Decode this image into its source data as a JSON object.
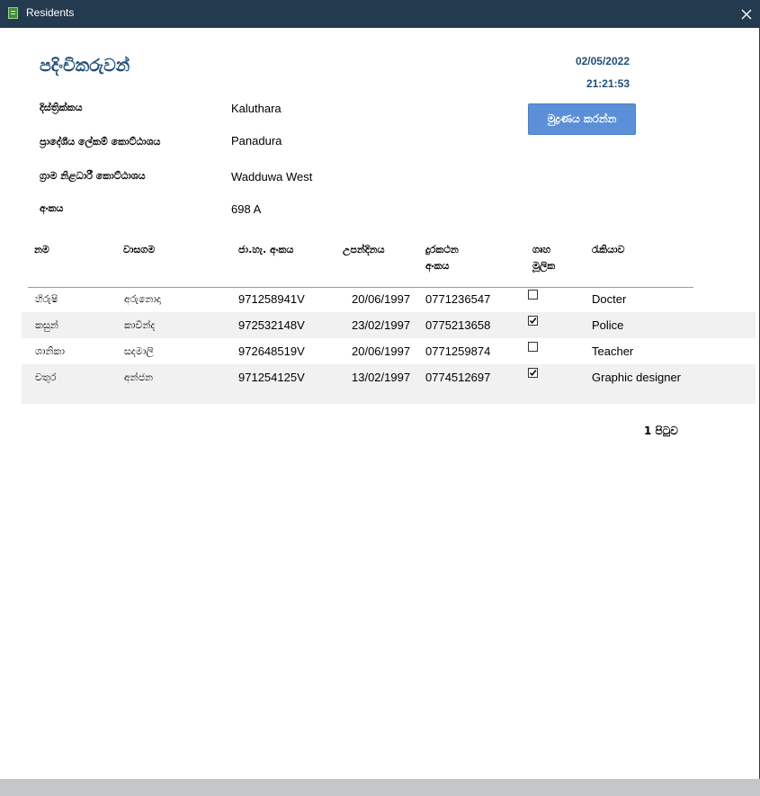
{
  "window": {
    "title": "Residents",
    "close_label": "✕"
  },
  "report": {
    "title": "පදිංචිකරුවන්",
    "date": "02/05/2022",
    "time": "21:21:53",
    "print_button": "මුද්‍රණය කරන්න"
  },
  "info": [
    {
      "label": "දිස්ත්‍රික්කය",
      "value": "Kaluthara"
    },
    {
      "label": "ප්‍රාදේශීය ලේකම් කොට්ඨාශය",
      "value": "Panadura"
    },
    {
      "label": "ග්‍රාම නිළධාරී කොට්ඨාශය",
      "value": "Wadduwa West"
    },
    {
      "label": "අංකය",
      "value": "698 A"
    }
  ],
  "table": {
    "headers": {
      "name": "නම",
      "surname": "වාසගම",
      "nic": "ජා.හැ. අංකය",
      "dob": "උපන්දිනය",
      "phone_1": "දුරකථන",
      "phone_2": "අංකය",
      "head_1": "ගෘහ",
      "head_2": "මූලික",
      "job": "රැකියාව"
    },
    "rows": [
      {
        "name": "හිරුෂි",
        "surname": "අරුනොදා",
        "nic": "971258941V",
        "dob": "20/06/1997",
        "phone": "0771236547",
        "head": false,
        "job": "Docter"
      },
      {
        "name": "කසුන්",
        "surname": "කාවින්ද",
        "nic": "972532148V",
        "dob": "23/02/1997",
        "phone": "0775213658",
        "head": true,
        "job": "Police"
      },
      {
        "name": "ශානිකා",
        "surname": "සදමාලි",
        "nic": "972648519V",
        "dob": "20/06/1997",
        "phone": "0771259874",
        "head": false,
        "job": "Teacher"
      },
      {
        "name": "චතුර",
        "surname": "අන්ජන",
        "nic": "971254125V",
        "dob": "13/02/1997",
        "phone": "0774512697",
        "head": true,
        "job": "Graphic designer"
      }
    ]
  },
  "footer": {
    "page": "1 පිටුව"
  }
}
